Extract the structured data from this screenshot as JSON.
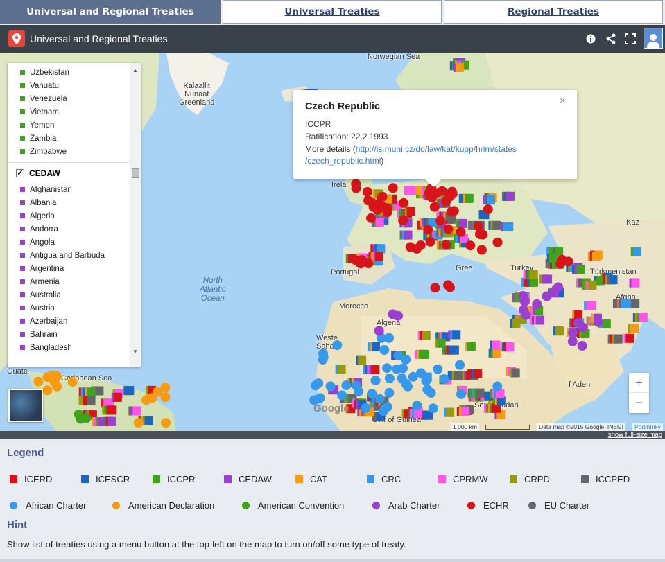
{
  "tabs": [
    {
      "label": "Universal and Regional Treaties"
    },
    {
      "label": "Universal Treaties"
    },
    {
      "label": "Regional Treaties"
    }
  ],
  "map": {
    "title": "Universal and Regional Treaties",
    "labels": {
      "greenland": "Kalaallit\nNunaat\nGreenland",
      "norwegian_sea": "Norwegian Sea",
      "north_atlantic": "North\nAtlantic\nOcean",
      "caribbean": "Caribbean Sea",
      "gulf_guinea": "Gulf of Guinea",
      "ireland": "Irela",
      "portugal": "Portugal",
      "morocco": "Morocco",
      "algeria": "Algeria",
      "western_sahara": "Weste\nSaha",
      "turkey": "Turkey",
      "greece": "Gree",
      "south_sudan": "South Sudan",
      "turkmenistan": "Türkmenistan",
      "afghanistan": "Afgha",
      "kaz": "Kaz",
      "guate": "Guate",
      "aden": "f Aden"
    },
    "google": "Google",
    "scale_label": "1 000 km",
    "attribution": "Data map ©2015 Google, INEGI",
    "terms": "Podmínky",
    "full_size": "show full-size map"
  },
  "panel": {
    "top_items": [
      {
        "name": "Uzbekistan"
      },
      {
        "name": "Vanuatu"
      },
      {
        "name": "Venezuela"
      },
      {
        "name": "Vietnam"
      },
      {
        "name": "Yemen"
      },
      {
        "name": "Zambia"
      },
      {
        "name": "Zimbabwe"
      }
    ],
    "group_label": "CEDAW",
    "group_checked": "✓",
    "items": [
      {
        "name": "Afghanistan"
      },
      {
        "name": "Albania"
      },
      {
        "name": "Algeria"
      },
      {
        "name": "Andorra"
      },
      {
        "name": "Angola"
      },
      {
        "name": "Antigua and Barbuda"
      },
      {
        "name": "Argentina"
      },
      {
        "name": "Armenia"
      },
      {
        "name": "Australia"
      },
      {
        "name": "Austria"
      },
      {
        "name": "Azerbaijan"
      },
      {
        "name": "Bahrain"
      },
      {
        "name": "Bangladesh"
      }
    ]
  },
  "popup": {
    "title": "Czech Republic",
    "treaty": "ICCPR",
    "ratification": "Ratification: 22.2.1993",
    "details_prefix": "More details (",
    "link_line1": "http://is.muni.cz/do/law/kat/kupp/hrim/states",
    "link_line2": "/czech_republic.html",
    "details_suffix": ")",
    "close": "×"
  },
  "zoom": {
    "in": "+",
    "out": "−"
  },
  "legend": {
    "title": "Legend",
    "squares": [
      {
        "label": "ICERD",
        "color": "#d7141a"
      },
      {
        "label": "ICESCR",
        "color": "#1a66c2"
      },
      {
        "label": "ICCPR",
        "color": "#3fa31b"
      },
      {
        "label": "CEDAW",
        "color": "#9b3fd1"
      },
      {
        "label": "CAT",
        "color": "#f79a14"
      },
      {
        "label": "CRC",
        "color": "#3598eb"
      },
      {
        "label": "CPRMW",
        "color": "#ff55e8"
      },
      {
        "label": "CRPD",
        "color": "#9a9a0f"
      },
      {
        "label": "ICCPED",
        "color": "#666666"
      }
    ],
    "dots": [
      {
        "label": "African Charter",
        "color": "#3598eb"
      },
      {
        "label": "American Declaration",
        "color": "#f79a14"
      },
      {
        "label": "American Convention",
        "color": "#3fa31b"
      },
      {
        "label": "Arab Charter",
        "color": "#9b3fd1"
      },
      {
        "label": "ECHR",
        "color": "#d7141a"
      },
      {
        "label": "EU Charter",
        "color": "#666666"
      }
    ]
  },
  "hint": {
    "title": "Hint",
    "text": "Show list of treaties using a menu button at the top-left on the map to turn on/off some type of treaty."
  }
}
